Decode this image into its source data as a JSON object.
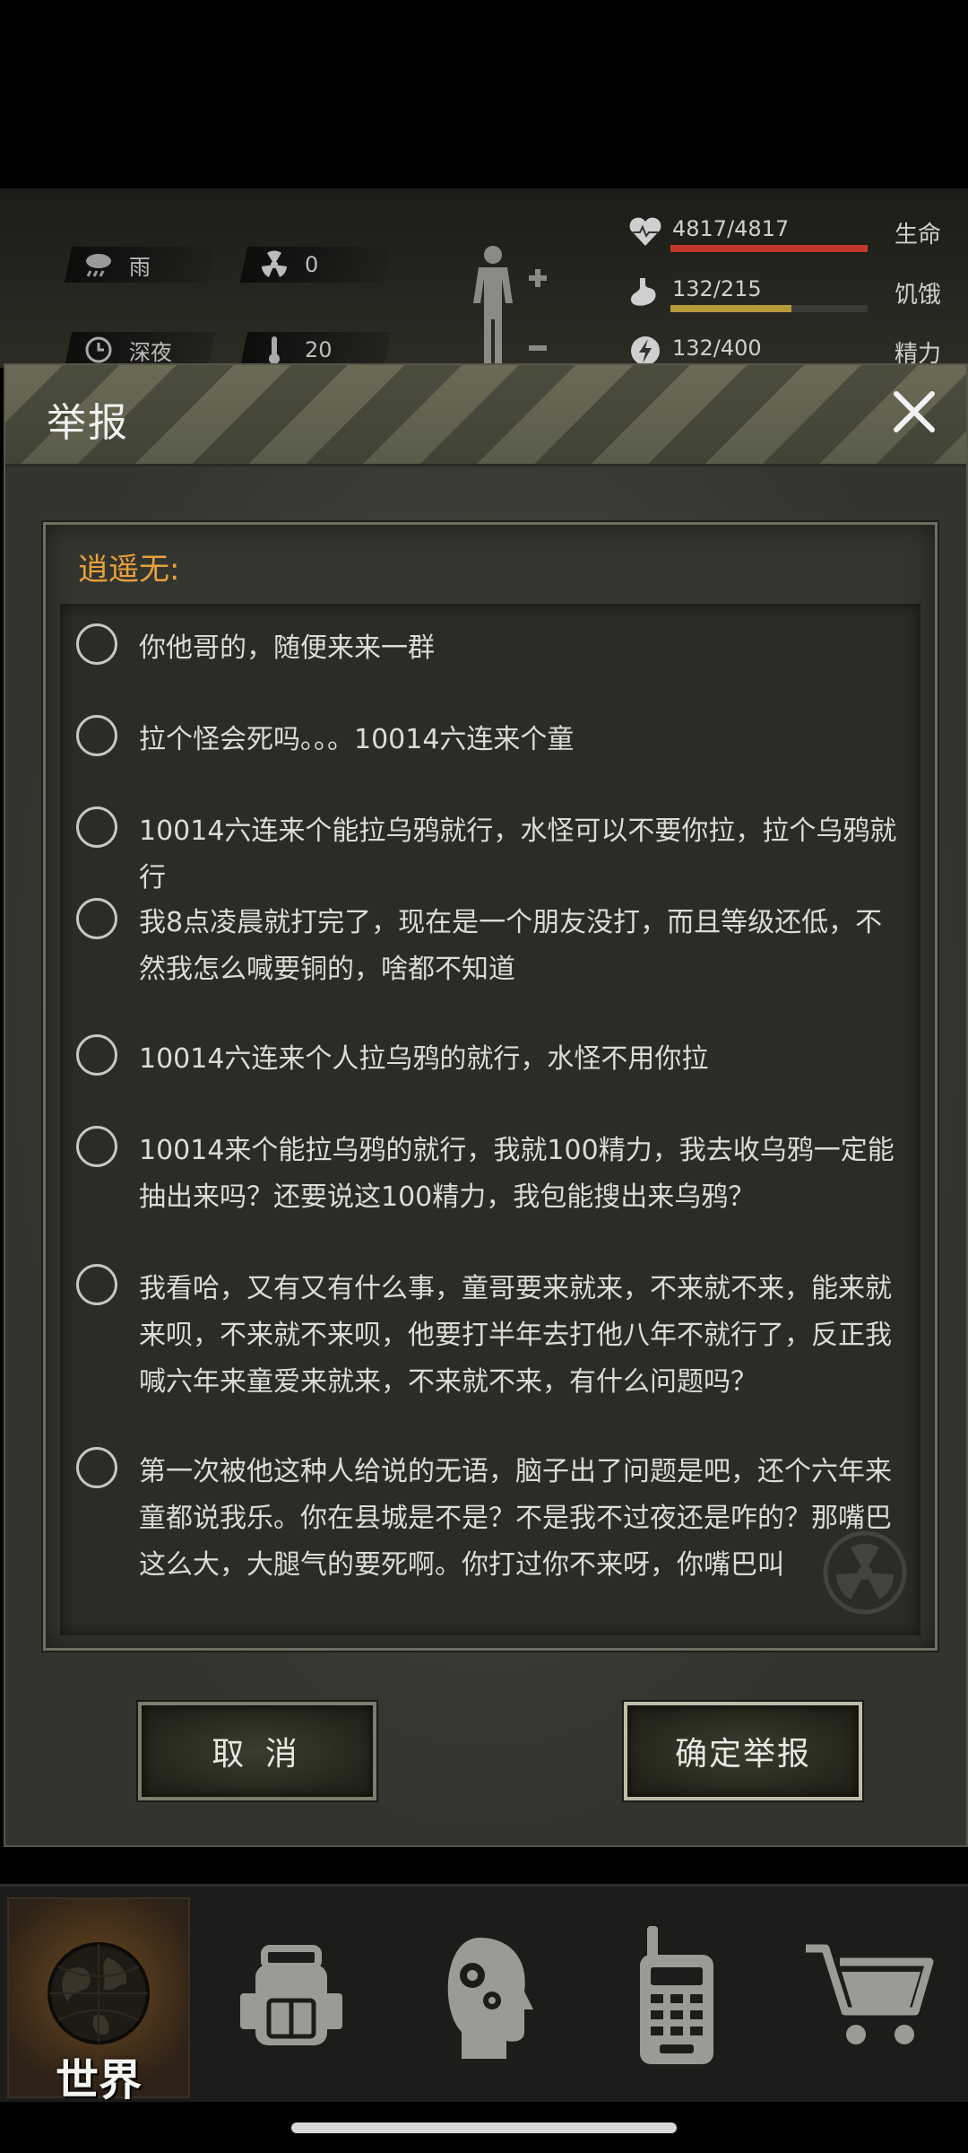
{
  "hud": {
    "weather": "雨",
    "radiation": "0",
    "time_of_day": "深夜",
    "temperature": "20",
    "stats": [
      {
        "label": "生命",
        "value": "4817/4817",
        "fraction": 1.0,
        "color": "#c0392b",
        "icon": "heart-icon"
      },
      {
        "label": "饥饿",
        "value": "132/215",
        "fraction": 0.614,
        "color": "#b59a3a",
        "icon": "stomach-icon"
      },
      {
        "label": "精力",
        "value": "132/400",
        "fraction": 0.33,
        "color": "#5a8aa8",
        "icon": "energy-icon"
      }
    ]
  },
  "dialog": {
    "title": "举报",
    "reported_user": "逍遥无:",
    "messages": [
      "你他哥的，随便来来一群",
      "拉个怪会死吗。。。10014六连来个童",
      "10014六连来个能拉乌鸦就行，水怪可以不要你拉，拉个乌鸦就行",
      "我8点凌晨就打完了，现在是一个朋友没打，而且等级还低，不然我怎么喊要铜的，啥都不知道",
      "10014六连来个人拉乌鸦的就行，水怪不用你拉",
      "10014来个能拉乌鸦的就行，我就100精力，我去收乌鸦一定能抽出来吗？还要说这100精力，我包能搜出来乌鸦？",
      "我看哈，又有又有什么事，童哥要来就来，不来就不来，能来就来呗，不来就不来呗，他要打半年去打他八年不就行了，反正我喊六年来童爱来就来，不来就不来，有什么问题吗？",
      "第一次被他这种人给说的无语，脑子出了问题是吧，还个六年来童都说我乐。你在县城是不是？不是我不过夜还是咋的？那嘴巴这么大，大腿气的要死啊。你打过你不来呀，你嘴巴叫"
    ],
    "cancel_label": "取 消",
    "confirm_label": "确定举报"
  },
  "nav": {
    "active_label": "世界",
    "items": [
      "world-tab",
      "backpack-tab",
      "skills-tab",
      "radio-tab",
      "shop-tab"
    ]
  }
}
